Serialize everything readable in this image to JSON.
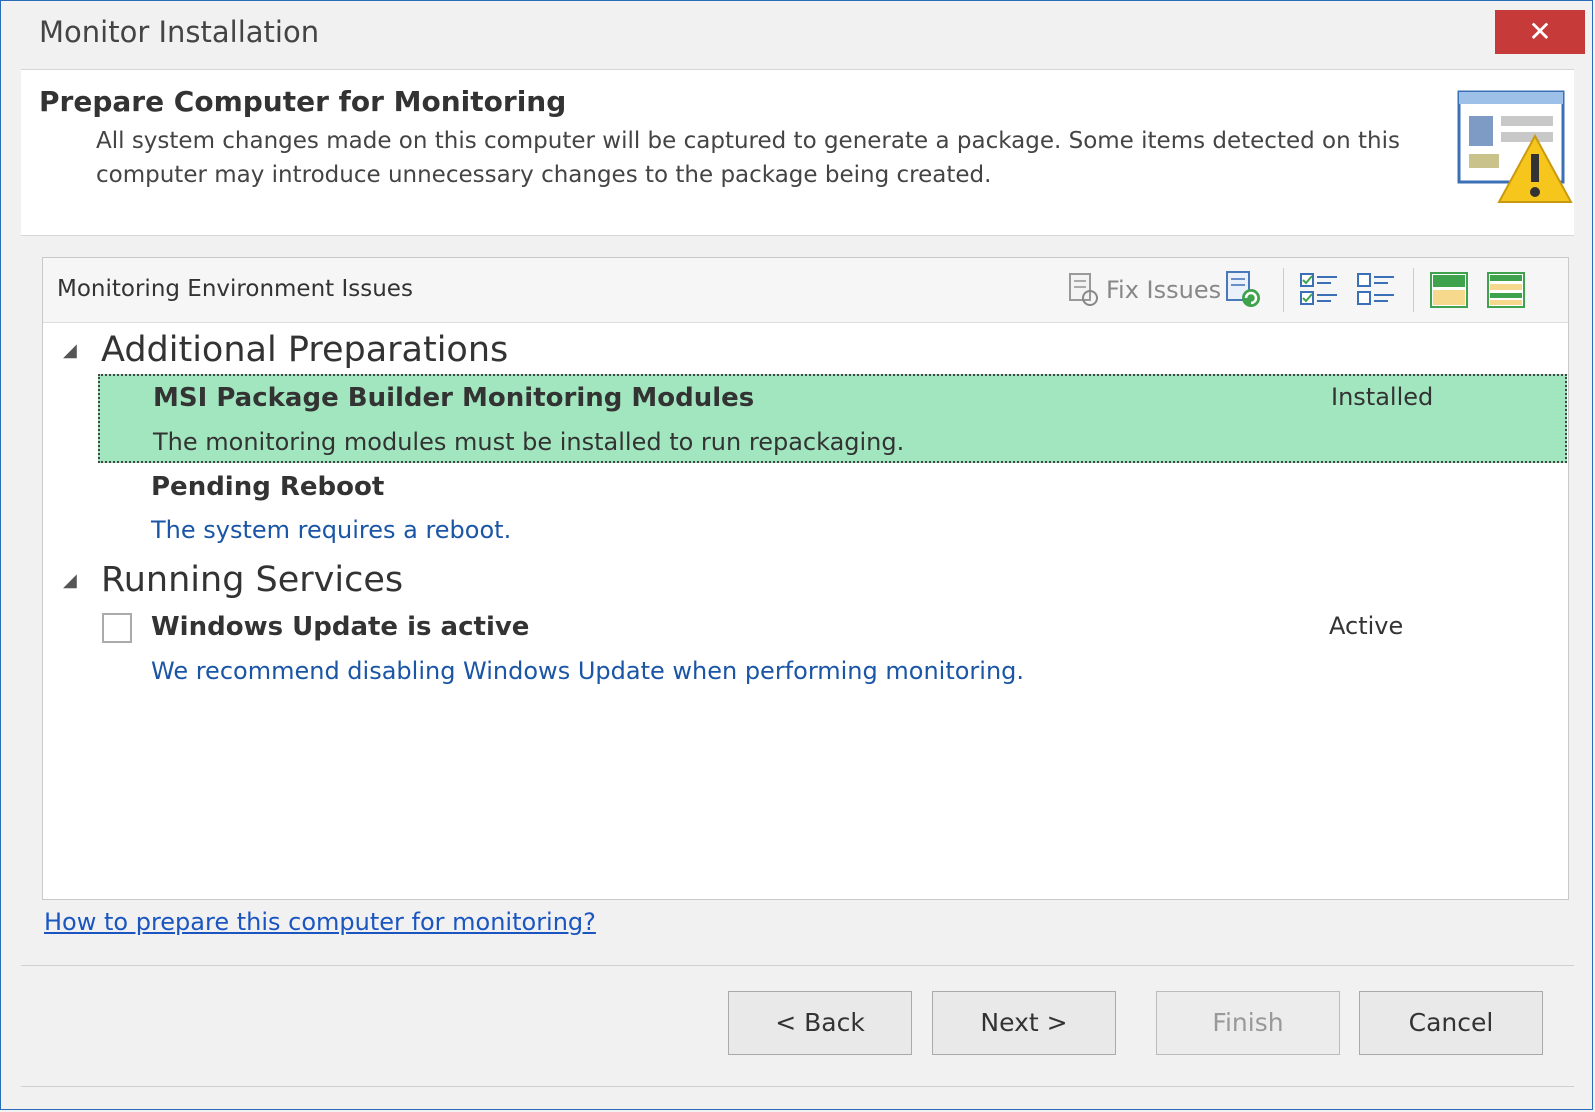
{
  "window": {
    "title": "Monitor Installation",
    "close_glyph": "✕"
  },
  "header": {
    "title": "Prepare Computer for Monitoring",
    "description": "All system changes made on this computer will be captured to generate a package. Some items detected on this computer may introduce unnecessary changes to the package being created.",
    "icon": "window-warning-icon"
  },
  "panel": {
    "title": "Monitoring Environment Issues",
    "toolbar": {
      "fix_issues_label": "Fix Issues",
      "icons": [
        "fix-issues-icon",
        "refresh-icon",
        "check-all-icon",
        "uncheck-all-icon",
        "expand-view-icon",
        "collapse-view-icon"
      ]
    },
    "groups": [
      {
        "label": "Additional Preparations",
        "items": [
          {
            "title": "MSI Package Builder Monitoring Modules",
            "description": "The monitoring modules must be installed to run repackaging.",
            "status": "Installed",
            "selected": true,
            "has_checkbox": false
          },
          {
            "title": "Pending Reboot",
            "description": "The system requires a reboot.",
            "status": "",
            "selected": false,
            "has_checkbox": false
          }
        ]
      },
      {
        "label": "Running Services",
        "items": [
          {
            "title": "Windows Update is active",
            "description": "We recommend disabling Windows Update when performing monitoring.",
            "status": "Active",
            "selected": false,
            "has_checkbox": true,
            "checked": false
          }
        ]
      }
    ]
  },
  "help_link": "How to prepare this computer for monitoring?",
  "buttons": {
    "back": "< Back",
    "next": "Next >",
    "finish": "Finish",
    "cancel": "Cancel"
  },
  "colors": {
    "selected_row": "#a1e6bf",
    "link": "#1a55c0",
    "description_text": "#1a55a6",
    "close_button": "#c73a3a"
  }
}
